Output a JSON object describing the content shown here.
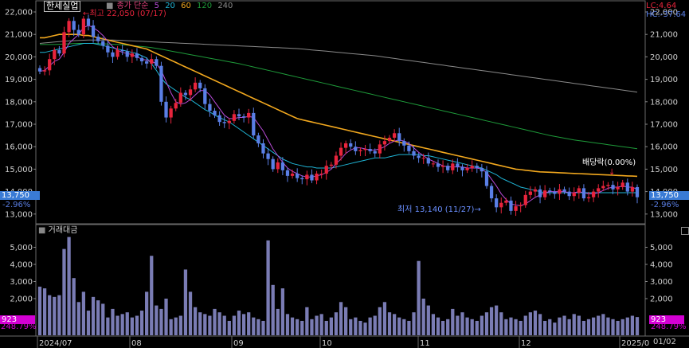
{
  "header": {
    "ticker": "한세실업",
    "legend_prefix": "종가 단순",
    "ma_periods": [
      {
        "label": "5",
        "color": "#b84bd8"
      },
      {
        "label": "20",
        "color": "#1fb5d6"
      },
      {
        "label": "60",
        "color": "#f2a81e"
      },
      {
        "label": "120",
        "color": "#1e9b3a"
      },
      {
        "label": "240",
        "color": "#8a8a8a"
      }
    ],
    "high_note": "최고 22,050 (07/17)",
    "low_note": "최저 13,140 (11/27)",
    "ex_dividend_note": "배당락(0.00%)",
    "lc_label": "LC:4.64",
    "hc_label": "HC:-37.64"
  },
  "current": {
    "price_label": "13,750",
    "change_label": "-2.96%",
    "volume_label": "923",
    "volume_change_label": "248.79%"
  },
  "volume_panel": {
    "title": "거래대금"
  },
  "chart_data": {
    "type": "candlestick",
    "up_color": "#e8243c",
    "down_color": "#5a7fe6",
    "price_ylim": [
      13000,
      22000
    ],
    "price_ticks": [
      "22,000",
      "21,000",
      "20,000",
      "19,000",
      "18,000",
      "17,000",
      "16,000",
      "15,000",
      "14,000",
      "13,000"
    ],
    "volume_ylim": [
      0,
      6000
    ],
    "volume_ticks": [
      "5,000",
      "4,000",
      "3,000",
      "2,000"
    ],
    "x_tick_labels": [
      "2024/07",
      "08",
      "09",
      "10",
      "11",
      "12",
      "2025/0"
    ],
    "right_x_label": "01/02",
    "candle_count": 124,
    "close": [
      19350,
      19400,
      19900,
      20300,
      20150,
      21100,
      21600,
      21200,
      21000,
      21700,
      21400,
      20900,
      20700,
      20500,
      20200,
      20000,
      20300,
      20250,
      20000,
      20150,
      19950,
      19800,
      19700,
      19900,
      19600,
      18000,
      17300,
      17700,
      17950,
      18400,
      18300,
      18550,
      18850,
      18600,
      17900,
      17600,
      17400,
      17100,
      17050,
      17150,
      17450,
      17350,
      17300,
      17500,
      16500,
      16150,
      15700,
      15450,
      15000,
      15300,
      14950,
      14700,
      14800,
      14600,
      14550,
      14750,
      14500,
      14800,
      14800,
      15150,
      15200,
      15600,
      15950,
      16150,
      16000,
      15800,
      15850,
      15900,
      15800,
      15700,
      16100,
      16250,
      16400,
      16600,
      16250,
      16050,
      15800,
      15600,
      15500,
      15500,
      15250,
      15250,
      15100,
      15150,
      14950,
      15250,
      15100,
      14950,
      15050,
      15150,
      15050,
      14900,
      14250,
      13700,
      13300,
      13500,
      13600,
      13140,
      13350,
      13400,
      13850,
      14000,
      14100,
      13750,
      14050,
      14000,
      13900,
      14100,
      14000,
      13800,
      13950,
      14150,
      13700,
      13750,
      14000,
      14150,
      14250,
      14300,
      14100,
      14200,
      14400,
      14000,
      14200,
      13750
    ],
    "volume": [
      2700,
      2600,
      2200,
      2100,
      2200,
      4900,
      5600,
      3200,
      1800,
      2400,
      1300,
      2100,
      1900,
      1700,
      900,
      1400,
      1000,
      1100,
      1200,
      900,
      1000,
      1300,
      2400,
      4500,
      1600,
      1400,
      2000,
      800,
      900,
      1000,
      3700,
      2400,
      1500,
      1200,
      1100,
      1000,
      1400,
      1200,
      1000,
      700,
      1000,
      1300,
      1100,
      1200,
      900,
      800,
      700,
      5400,
      2800,
      1400,
      2600,
      1100,
      900,
      800,
      700,
      1500,
      800,
      1000,
      1100,
      700,
      900,
      1200,
      1800,
      1500,
      800,
      900,
      700,
      600,
      900,
      1000,
      1500,
      1800,
      1200,
      1100,
      900,
      800,
      700,
      1200,
      4200,
      2000,
      1600,
      1100,
      900,
      700,
      800,
      1400,
      1000,
      1200,
      900,
      800,
      700,
      1000,
      1200,
      1500,
      1600,
      1200,
      800,
      900,
      800,
      700,
      1000,
      1200,
      1300,
      1100,
      700,
      800,
      600,
      900,
      1000,
      800,
      1100,
      1000,
      700,
      800,
      900,
      1000,
      1100,
      900,
      800,
      700,
      800,
      900,
      1000,
      923
    ],
    "moving_averages": [
      {
        "name": "5",
        "color": "#b84bd8",
        "values": [
          19350,
          19400,
          19600,
          19800,
          19900,
          20200,
          20600,
          20800,
          21000,
          21300,
          21400,
          21300,
          21150,
          20950,
          20700,
          20450,
          20300,
          20200,
          20150,
          20100,
          20000,
          19900,
          19850,
          19800,
          19700,
          19400,
          18900,
          18400,
          18000,
          17900,
          17950,
          18100,
          18300,
          18500,
          18500,
          18300,
          18000,
          17700,
          17400,
          17250,
          17250,
          17300,
          17300,
          17350,
          17300,
          17000,
          16700,
          16300,
          15900,
          15600,
          15300,
          15050,
          14900,
          14800,
          14700,
          14650,
          14650,
          14700,
          14750,
          14850,
          15000,
          15250,
          15450,
          15700,
          15850,
          15950,
          15950,
          15900,
          15850,
          15850,
          15900,
          16000,
          16150,
          16250,
          16300,
          16250,
          16150,
          15950,
          15750,
          15600,
          15450,
          15350,
          15250,
          15150,
          15100,
          15100,
          15100,
          15100,
          15050,
          15050,
          15050,
          15000,
          14850,
          14550,
          14250,
          13900,
          13650,
          13450,
          13400,
          13380,
          13450,
          13600,
          13750,
          13850,
          13950,
          14000,
          14000,
          14000,
          14000,
          13950,
          13950,
          14000,
          13950,
          13900,
          13900,
          13950,
          14050,
          14150,
          14200,
          14200,
          14250,
          14200,
          14200,
          14100
        ]
      },
      {
        "name": "20",
        "color": "#1fb5d6",
        "values": [
          20200,
          20200,
          20250,
          20300,
          20350,
          20400,
          20450,
          20500,
          20550,
          20600,
          20600,
          20600,
          20550,
          20500,
          20450,
          20400,
          20350,
          20300,
          20250,
          20200,
          20150,
          20050,
          19950,
          19700,
          19400,
          19050,
          18800,
          18650,
          18500,
          18350,
          18200,
          18100,
          17950,
          17800,
          17650,
          17550,
          17400,
          17300,
          17200,
          17100,
          16950,
          16800,
          16650,
          16500,
          16350,
          16200,
          16050,
          15900,
          15750,
          15600,
          15450,
          15350,
          15250,
          15200,
          15150,
          15100,
          15100,
          15050,
          15050,
          15050,
          15050,
          15100,
          15150,
          15200,
          15250,
          15300,
          15350,
          15400,
          15450,
          15500,
          15500,
          15500,
          15550,
          15600,
          15650,
          15650,
          15650,
          15650,
          15650,
          15600,
          15600,
          15550,
          15500,
          15450,
          15400,
          15350,
          15300,
          15250,
          15200,
          15150,
          15100,
          15050,
          14950,
          14850,
          14750,
          14600,
          14500,
          14400,
          14300,
          14200,
          14150,
          14100,
          14050,
          14000,
          13950,
          13950,
          13950,
          13950,
          13950,
          13950,
          13950,
          13950,
          13950,
          13950,
          13950,
          13950,
          13950,
          13950,
          13950,
          13950,
          13950,
          13950,
          13950,
          13950
        ]
      },
      {
        "name": "60",
        "color": "#f2a81e",
        "values": [
          20850,
          20850,
          20900,
          20950,
          21000,
          21000,
          21000,
          21000,
          21000,
          20950,
          20950,
          20900,
          20850,
          20800,
          20750,
          20700,
          20650,
          20600,
          20550,
          20500,
          20450,
          20400,
          20350,
          20250,
          20150,
          20050,
          19950,
          19850,
          19750,
          19650,
          19550,
          19450,
          19350,
          19250,
          19150,
          19050,
          18950,
          18850,
          18750,
          18650,
          18550,
          18450,
          18350,
          18250,
          18150,
          18050,
          17950,
          17850,
          17750,
          17650,
          17550,
          17450,
          17350,
          17250,
          17200,
          17150,
          17100,
          17050,
          17000,
          16950,
          16900,
          16850,
          16800,
          16750,
          16700,
          16650,
          16600,
          16550,
          16500,
          16450,
          16400,
          16350,
          16300,
          16250,
          16200,
          16150,
          16100,
          16050,
          16000,
          15950,
          15900,
          15850,
          15800,
          15750,
          15700,
          15650,
          15600,
          15550,
          15500,
          15450,
          15400,
          15350,
          15300,
          15250,
          15200,
          15150,
          15100,
          15050,
          15000,
          14980,
          14950,
          14930,
          14900,
          14880,
          14870,
          14860,
          14850,
          14840,
          14830,
          14820,
          14810,
          14800,
          14790,
          14780,
          14770,
          14760,
          14750,
          14740,
          14730,
          14720,
          14710,
          14700,
          14690,
          14680
        ]
      },
      {
        "name": "120",
        "color": "#1e9b3a",
        "values": [
          20550,
          20550,
          20550,
          20550,
          20560,
          20570,
          20580,
          20590,
          20600,
          20600,
          20600,
          20600,
          20590,
          20580,
          20570,
          20560,
          20550,
          20540,
          20520,
          20500,
          20480,
          20460,
          20440,
          20410,
          20380,
          20340,
          20300,
          20260,
          20220,
          20180,
          20140,
          20100,
          20060,
          20020,
          19980,
          19940,
          19900,
          19860,
          19820,
          19780,
          19740,
          19700,
          19650,
          19600,
          19550,
          19500,
          19450,
          19400,
          19350,
          19300,
          19250,
          19200,
          19150,
          19100,
          19050,
          19000,
          18950,
          18900,
          18850,
          18800,
          18750,
          18700,
          18650,
          18600,
          18550,
          18500,
          18450,
          18400,
          18350,
          18300,
          18250,
          18200,
          18150,
          18100,
          18050,
          18000,
          17950,
          17900,
          17850,
          17800,
          17750,
          17700,
          17650,
          17600,
          17550,
          17500,
          17450,
          17400,
          17350,
          17300,
          17250,
          17200,
          17150,
          17100,
          17050,
          17000,
          16950,
          16900,
          16850,
          16800,
          16750,
          16700,
          16650,
          16600,
          16550,
          16500,
          16460,
          16420,
          16380,
          16340,
          16300,
          16270,
          16240,
          16210,
          16180,
          16150,
          16120,
          16090,
          16060,
          16030,
          16000,
          15970,
          15940,
          15910
        ]
      },
      {
        "name": "240",
        "color": "#8a8a8a",
        "values": [
          20600,
          20620,
          20640,
          20660,
          20680,
          20700,
          20710,
          20720,
          20730,
          20740,
          20750,
          20750,
          20750,
          20750,
          20750,
          20750,
          20740,
          20730,
          20720,
          20710,
          20700,
          20690,
          20680,
          20670,
          20660,
          20650,
          20640,
          20630,
          20620,
          20610,
          20600,
          20590,
          20580,
          20570,
          20560,
          20550,
          20540,
          20530,
          20520,
          20510,
          20500,
          20490,
          20480,
          20470,
          20460,
          20450,
          20440,
          20430,
          20420,
          20410,
          20400,
          20390,
          20380,
          20370,
          20350,
          20330,
          20310,
          20290,
          20270,
          20250,
          20230,
          20210,
          20190,
          20170,
          20150,
          20130,
          20110,
          20090,
          20070,
          20050,
          20020,
          19990,
          19960,
          19930,
          19900,
          19870,
          19840,
          19810,
          19780,
          19750,
          19720,
          19690,
          19660,
          19630,
          19600,
          19570,
          19540,
          19510,
          19480,
          19450,
          19420,
          19390,
          19360,
          19330,
          19300,
          19270,
          19240,
          19210,
          19180,
          19150,
          19120,
          19090,
          19060,
          19030,
          19000,
          18970,
          18940,
          18910,
          18880,
          18850,
          18820,
          18790,
          18760,
          18730,
          18700,
          18670,
          18640,
          18610,
          18580,
          18550,
          18520,
          18490,
          18460,
          18430
        ]
      }
    ]
  }
}
